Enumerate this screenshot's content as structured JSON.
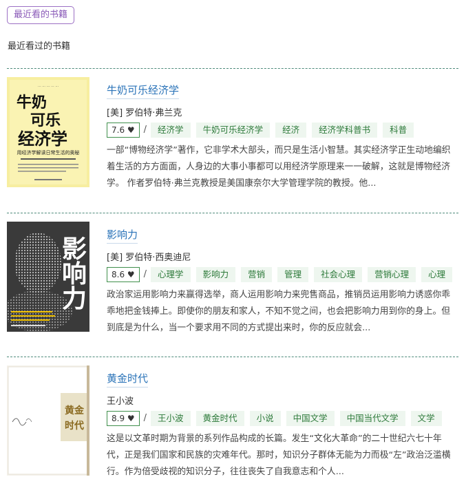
{
  "header": {
    "tab_label": "最近看的书籍",
    "section_title": "最近看过的书籍"
  },
  "books": [
    {
      "title": "牛奶可乐经济学",
      "author": "[美] 罗伯特·弗兰克",
      "rating": "7.6 ♥",
      "tags": [
        "经济学",
        "牛奶可乐经济学",
        "经济",
        "经济学科普书",
        "科普"
      ],
      "description": "一部“博物经济学”著作，它非学术大部头，而只是生活小智慧。其实经济学正生动地编织着生活的方方面面，人身边的大事小事都可以用经济学原理来一一破解，这就是博物经济学。 作者罗伯特·弗兰克教授是美国康奈尔大学管理学院的教授。他...",
      "cover": {
        "title_lines": [
          "牛奶",
          "可乐",
          "经济学"
        ],
        "subtitle": "用经济学解读日常生活的奥秘"
      }
    },
    {
      "title": "影响力",
      "author": "[美] 罗伯特·西奥迪尼",
      "rating": "8.6 ♥",
      "tags": [
        "心理学",
        "影响力",
        "营销",
        "管理",
        "社会心理",
        "营销心理",
        "心理"
      ],
      "description": "政治家运用影响力来赢得选举，商人运用影响力来兜售商品，推销员运用影响力诱惑你乖乖地把金钱捧上。即使你的朋友和家人，不知不觉之间，也会把影响力用到你的身上。但到底是为什么，当一个要求用不同的方式提出来时，你的反应就会...",
      "cover": {
        "title_lines": [
          "影",
          "响",
          "力"
        ]
      }
    },
    {
      "title": "黄金时代",
      "author": "王小波",
      "rating": "8.9 ♥",
      "tags": [
        "王小波",
        "黄金时代",
        "小说",
        "中国文学",
        "中国当代文学",
        "文学"
      ],
      "description": "这是以文革时期为背景的系列作品构成的长篇。发生“文化大革命”的二十世纪六七十年代，正是我们国家和民族的灾难年代。那时，知识分子群体无能为力而极“左”政治泛滥横行。作为倍受歧视的知识分子，往往丧失了自我意志和个人...",
      "cover": {
        "title_lines": [
          "黄金",
          "时代"
        ]
      }
    }
  ],
  "colors": {
    "accent_purple": "#8a5ab8",
    "link_blue": "#2a73b8",
    "tag_green": "#2d7a3a",
    "tag_bg": "#eef6ef",
    "divider": "#4d8a7a"
  }
}
